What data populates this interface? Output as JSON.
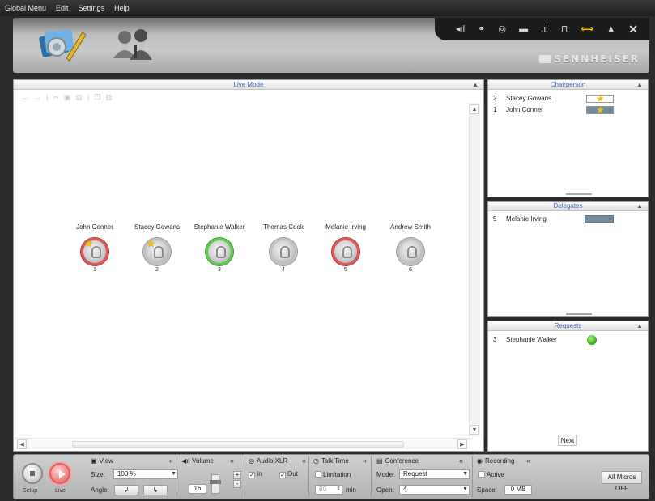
{
  "menu": [
    "Global Menu",
    "Edit",
    "Settings",
    "Help"
  ],
  "header": {
    "brand": "SENNHEISER",
    "icons": [
      "signal-icon",
      "link-icon",
      "sound-icon",
      "battery-icon",
      "signal-bars-icon",
      "lock-icon",
      "arrows-icon",
      "warning-icon",
      "close-icon"
    ]
  },
  "live": {
    "title": "Live Mode",
    "delegates": [
      {
        "name": "John Conner",
        "seat": "1",
        "state": "red",
        "chair": true
      },
      {
        "name": "Stacey Gowans",
        "seat": "2",
        "state": "gray",
        "chair": true
      },
      {
        "name": "Stephanie Walker",
        "seat": "3",
        "state": "green",
        "chair": false
      },
      {
        "name": "Thomas Cook",
        "seat": "4",
        "state": "gray",
        "chair": false
      },
      {
        "name": "Melanie Irving",
        "seat": "5",
        "state": "red",
        "chair": false
      },
      {
        "name": "Andrew Smith",
        "seat": "6",
        "state": "gray",
        "chair": false
      }
    ]
  },
  "chairperson": {
    "title": "Chairperson",
    "rows": [
      {
        "num": "2",
        "name": "Stacey Gowans"
      },
      {
        "num": "1",
        "name": "John Conner"
      }
    ]
  },
  "delegates_panel": {
    "title": "Delegates",
    "rows": [
      {
        "num": "5",
        "name": "Melanie Irving"
      }
    ]
  },
  "requests": {
    "title": "Requests",
    "rows": [
      {
        "num": "3",
        "name": "Stephanie Walker"
      }
    ],
    "next": "Next"
  },
  "bottom": {
    "setup": "Setup",
    "live": "Live",
    "view": {
      "title": "View",
      "size_label": "Size:",
      "size_value": "100 %",
      "angle_label": "Angle:"
    },
    "volume": {
      "title": "Volume",
      "value": "16",
      "plus": "+",
      "minus": "-"
    },
    "audio": {
      "title": "Audio XLR",
      "in": "In",
      "out": "Out"
    },
    "talktime": {
      "title": "Talk Time",
      "limitation": "Limitation",
      "value": "60",
      "unit": "min"
    },
    "conference": {
      "title": "Conference",
      "mode_label": "Mode:",
      "mode_value": "Request",
      "open_label": "Open:",
      "open_value": "4"
    },
    "recording": {
      "title": "Recording",
      "active": "Active",
      "space_label": "Space:",
      "space_value": "0 MB"
    },
    "all_off": "All Micros OFF"
  }
}
